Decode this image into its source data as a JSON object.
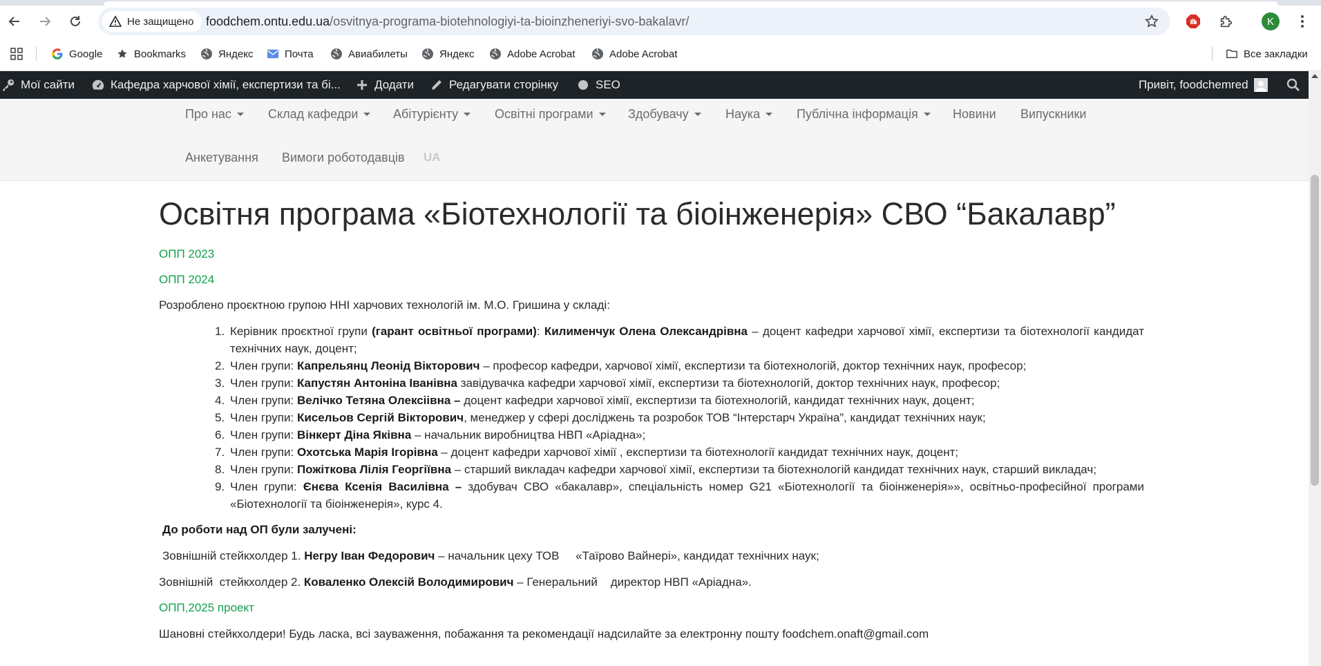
{
  "browser": {
    "security_label": "Не защищено",
    "url_host": "foodchem.ontu.edu.ua",
    "url_path": "/osvitnya-programa-biotehnologiyi-ta-bioinzheneriyi-svo-bakalavr/",
    "profile_initial": "K",
    "bookmarks": [
      {
        "label": "Google",
        "icon": "google-icon"
      },
      {
        "label": "Bookmarks",
        "icon": "star-icon"
      },
      {
        "label": "Яндекс",
        "icon": "globe-icon"
      },
      {
        "label": "Почта",
        "icon": "mail-icon"
      },
      {
        "label": "Авиабилеты",
        "icon": "globe-icon"
      },
      {
        "label": "Яндекс",
        "icon": "globe-icon"
      },
      {
        "label": "Adobe Acrobat",
        "icon": "globe-icon"
      },
      {
        "label": "Adobe Acrobat",
        "icon": "globe-icon"
      }
    ],
    "all_bookmarks": "Все закладки"
  },
  "adminbar": {
    "my_sites": "Мої сайти",
    "site_name": "Кафедра харчової хімії, експертизи та бі...",
    "add_new": "Додати",
    "edit_page": "Редагувати сторінку",
    "seo": "SEO",
    "greeting": "Привіт, foodchemred"
  },
  "sitenav": {
    "row1": [
      {
        "label": "Про нас",
        "dropdown": true
      },
      {
        "label": "Склад кафедри",
        "dropdown": true
      },
      {
        "label": "Абітурієнту",
        "dropdown": true
      },
      {
        "label": "Освітні програми",
        "dropdown": true
      },
      {
        "label": "Здобувачу",
        "dropdown": true
      },
      {
        "label": "Наука",
        "dropdown": true
      },
      {
        "label": "Публічна інформація",
        "dropdown": true
      },
      {
        "label": "Новини",
        "dropdown": false
      },
      {
        "label": "Випускники",
        "dropdown": false
      }
    ],
    "row2": [
      {
        "label": "Анкетування"
      },
      {
        "label": "Вимоги роботодавців"
      }
    ],
    "lang": "UA"
  },
  "page": {
    "title": "Освітня програма «Біотехнології та біоінженерія» СВО “Бакалавр”",
    "links": [
      "ОПП 2023",
      "ОПП 2024"
    ],
    "intro": "Розроблено проєктною групою ННІ харчових технологій ім. М.О.  Гришина  у складі:",
    "members": [
      {
        "num": "1.",
        "pre": "Керівник проєктної групи ",
        "mid": "(гарант освітньої програми)",
        "sep": ": ",
        "name": "Килименчук Олена Олександрівна",
        "post": " – доцент кафедри харчової хімії, експертизи та біотехнології кандидат технічних наук, доцент;"
      },
      {
        "num": "2.",
        "pre": "Член групи: ",
        "name": "Капрельянц Леонід Вікторович",
        "post": " – професор кафедри, харчової хімії, експертизи та біотехнологій, доктор технічних наук, професор;"
      },
      {
        "num": "3.",
        "pre": "Член групи: ",
        "name": "Капустян Антоніна Іванівна",
        "post": " завідувачка кафедри харчової хімії, експертизи та біотехнологій, доктор технічних наук, професор;"
      },
      {
        "num": "4.",
        "pre": "Член групи: ",
        "name": "Велічко Тетяна Олексіівна –",
        "post": " доцент кафедри харчової хімії, експертизи та біотехнологій, кандидат технічних наук, доцент;"
      },
      {
        "num": "5.",
        "pre": "Член групи: ",
        "name": "Кисельов Сергій Вікторович",
        "post": ", менеджер у сфері досліджень та розробок ТОВ “Інтерстарч Україна”, кандидат технічних наук;"
      },
      {
        "num": "6.",
        "pre": "Член групи: ",
        "name": "Вінкерт Діна Яківна",
        "post": " – начальник виробництва НВП «Аріадна»;"
      },
      {
        "num": "7.",
        "pre": "Член групи: ",
        "name": "Охотська Марія Ігорівна",
        "post": " – доцент кафедри харчової хімії , експертизи та біотехнології кандидат технічних наук, доцент;"
      },
      {
        "num": "8.",
        "pre": "Член групи: ",
        "name": "Пожіткова Лілія Георгіївна",
        "post": " – старший викладач кафедри харчової хімії, експертизи та біотехнологій кандидат технічних наук, старший викладач;"
      },
      {
        "num": "9.",
        "pre": "Член групи: ",
        "name": "Єнєва Ксенія Василівна –",
        "post": " здобувач СВО «бакалавр», спеціальність номер G21 «Біотехнології та біоінженерія»», освітньо-професійної програми «Біотехнології та біоінженерія», курс 4."
      }
    ],
    "involved_heading": "До роботи над ОП були залучені:",
    "stakeholder1": {
      "pre": "Зовнішній стейкхолдер 1. ",
      "name": "Негру Іван Федорович",
      "post": " – начальник цеху ТОВ     «Таїрово Вайнері», кандидат технічних наук;"
    },
    "stakeholder2": {
      "pre": "Зовнішній  стейкхолдер 2. ",
      "name": "Коваленко Олексій Володимирович",
      "post": " – Генеральний    директор НВП «Аріадна»."
    },
    "project_link": "ОПП,2025 проект",
    "footer_note": "Шановні стейкхолдери! Будь ласка, всі зауваження, побажання та рекомендації надсилайте за електронну пошту foodchem.onaft@gmail.com"
  },
  "colors": {
    "link_green": "#12a14b",
    "adminbar_bg": "#1d2327",
    "nav_bg": "#f5f5f5"
  }
}
